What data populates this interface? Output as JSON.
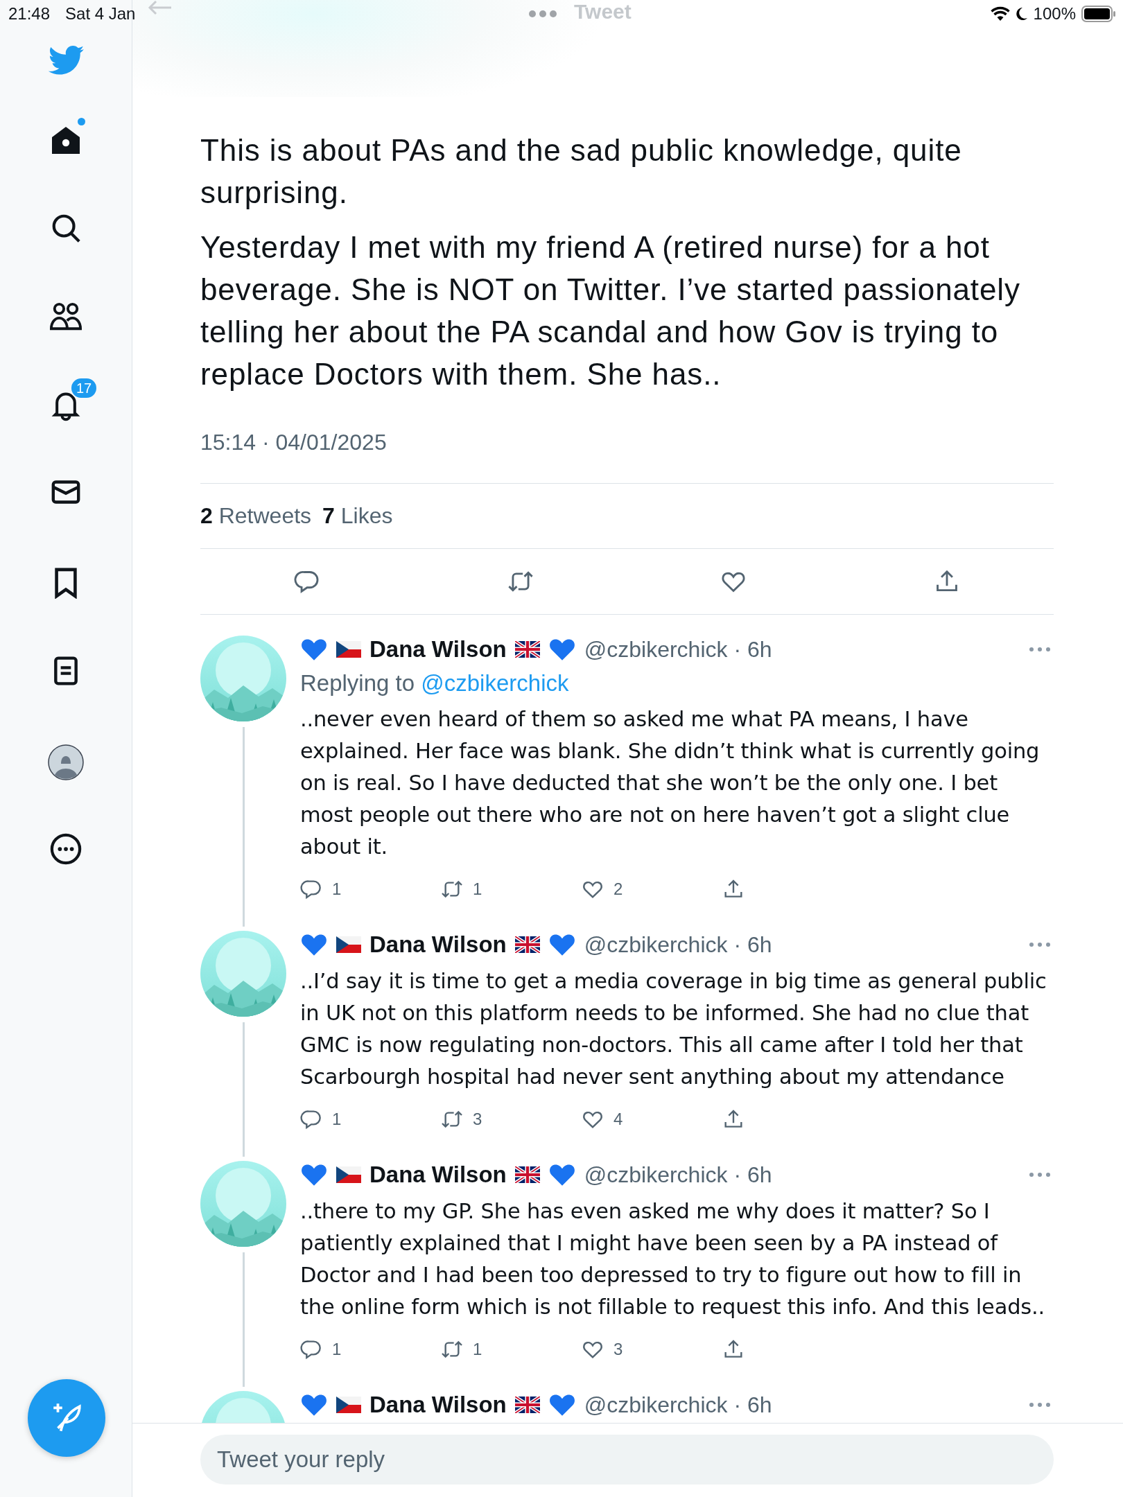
{
  "status_bar": {
    "time": "21:48",
    "date": "Sat 4 Jan",
    "battery": "100%"
  },
  "header": {
    "title": "Tweet"
  },
  "sidebar": {
    "items": [
      {
        "kind": "logo"
      },
      {
        "kind": "home",
        "unread": true
      },
      {
        "kind": "search"
      },
      {
        "kind": "communities"
      },
      {
        "kind": "notifications",
        "badge": "17"
      },
      {
        "kind": "messages"
      },
      {
        "kind": "bookmarks"
      },
      {
        "kind": "lists"
      },
      {
        "kind": "profile"
      },
      {
        "kind": "more"
      }
    ]
  },
  "tweet": {
    "paragraphs": [
      "This is about PAs and the sad public knowledge, quite surprising.",
      "Yesterday I met with my friend A (retired nurse) for a hot beverage. She is NOT on Twitter. I’ve started passionately telling her about the PA scandal and how Gov is trying to replace Doctors with them. She has.."
    ],
    "timestamp": "15:14 · 04/01/2025",
    "stats": [
      {
        "count": "2",
        "label": "Retweets"
      },
      {
        "count": "7",
        "label": "Likes"
      }
    ],
    "actions": [
      {
        "kind": "reply"
      },
      {
        "kind": "retweet"
      },
      {
        "kind": "like"
      },
      {
        "kind": "share"
      }
    ]
  },
  "replies": [
    {
      "name": "Dana Wilson",
      "meta": "@czbikerchick · 6h",
      "replying_label": "Replying to",
      "replying_to": "@czbikerchick",
      "text": "..never even heard of them so asked me what PA means, I have explained. Her face was blank. She didn’t think what is currently going on is real. So I have deducted that she won’t be the only one. I bet most people out there who are not on here haven’t got a slight clue about it.",
      "actions": [
        {
          "kind": "reply",
          "count": "1"
        },
        {
          "kind": "retweet",
          "count": "1"
        },
        {
          "kind": "like",
          "count": "2"
        },
        {
          "kind": "share"
        }
      ]
    },
    {
      "name": "Dana Wilson",
      "meta": "@czbikerchick · 6h",
      "text": "..I’d say it is time to get a media coverage in big time as general public in UK not on this platform needs to be informed. She had no clue that GMC is now regulating non-doctors. This all came after I told her that Scarbourgh hospital had never sent anything about my attendance",
      "actions": [
        {
          "kind": "reply",
          "count": "1"
        },
        {
          "kind": "retweet",
          "count": "3"
        },
        {
          "kind": "like",
          "count": "4"
        },
        {
          "kind": "share"
        }
      ]
    },
    {
      "name": "Dana Wilson",
      "meta": "@czbikerchick · 6h",
      "text": "..there to my GP. She has even asked me why does it matter? So I patiently explained that I might have been seen by a PA instead of Doctor and I had been too depressed to try to figure out how to fill in the online form which is not fillable to request this info. And this leads..",
      "actions": [
        {
          "kind": "reply",
          "count": "1"
        },
        {
          "kind": "retweet",
          "count": "1"
        },
        {
          "kind": "like",
          "count": "3"
        },
        {
          "kind": "share"
        }
      ]
    },
    {
      "name": "Dana Wilson",
      "meta": "@czbikerchick · 6h"
    }
  ],
  "reply_box": {
    "placeholder": "Tweet your reply"
  }
}
